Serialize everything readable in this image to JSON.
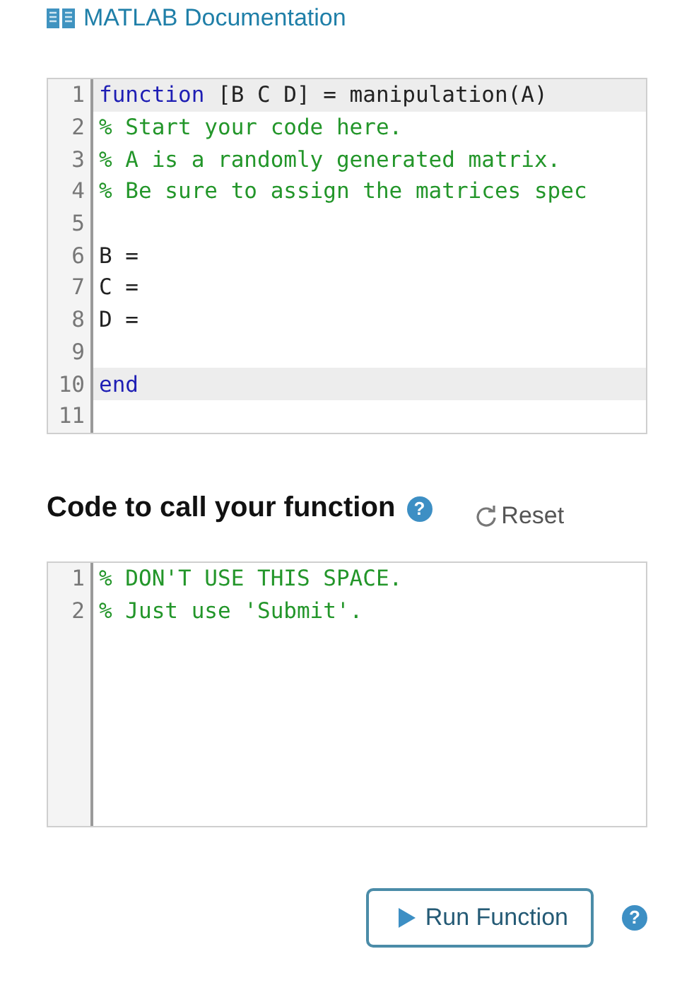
{
  "doc_link": {
    "label": "MATLAB Documentation"
  },
  "function_editor": {
    "lines": [
      {
        "number": "1",
        "highlighted": true,
        "segments": [
          {
            "kind": "keyword",
            "text": "function"
          },
          {
            "kind": "plain",
            "text": " [B C D] = manipulation(A)"
          }
        ]
      },
      {
        "number": "2",
        "highlighted": false,
        "segments": [
          {
            "kind": "comment",
            "text": "% Start your code here."
          }
        ]
      },
      {
        "number": "3",
        "highlighted": false,
        "segments": [
          {
            "kind": "comment",
            "text": "% A is a randomly generated matrix."
          }
        ]
      },
      {
        "number": "4",
        "highlighted": false,
        "segments": [
          {
            "kind": "comment",
            "text": "% Be sure to assign the matrices spec"
          }
        ]
      },
      {
        "number": "5",
        "highlighted": false
      },
      {
        "number": "6",
        "highlighted": false,
        "segments": [
          {
            "kind": "plain",
            "text": "B ="
          }
        ]
      },
      {
        "number": "7",
        "highlighted": false,
        "segments": [
          {
            "kind": "plain",
            "text": "C ="
          }
        ]
      },
      {
        "number": "8",
        "highlighted": false,
        "segments": [
          {
            "kind": "plain",
            "text": "D ="
          }
        ]
      },
      {
        "number": "9",
        "highlighted": false
      },
      {
        "number": "10",
        "highlighted": true,
        "segments": [
          {
            "kind": "keyword",
            "text": "end"
          }
        ]
      },
      {
        "number": "11",
        "highlighted": false
      }
    ]
  },
  "call_section": {
    "heading": "Code to call your function",
    "help": "?",
    "reset_label": "Reset"
  },
  "call_editor": {
    "lines": [
      {
        "number": "1",
        "highlighted": false,
        "segments": [
          {
            "kind": "comment",
            "text": "% DON'T USE THIS SPACE."
          }
        ]
      },
      {
        "number": "2",
        "highlighted": false,
        "segments": [
          {
            "kind": "comment",
            "text": "% Just use 'Submit'."
          }
        ]
      }
    ]
  },
  "run_button": {
    "label": "Run Function",
    "help": "?"
  }
}
